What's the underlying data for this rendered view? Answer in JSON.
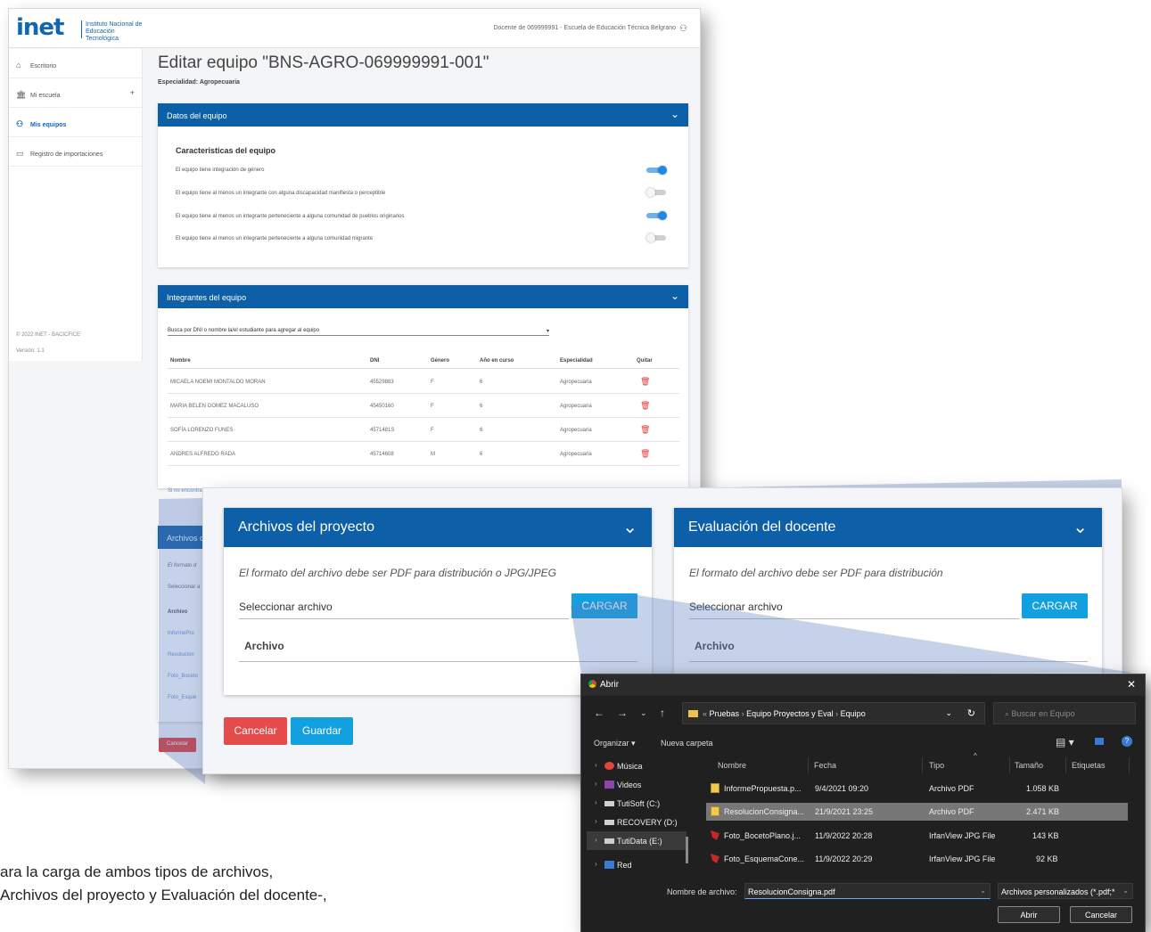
{
  "app": {
    "logo": "inet",
    "logo_subtitle": "Instituto Nacional de Educación Tecnológica",
    "teacher_label": "Docente de 069999991 - Escuela de Educación Técnica Belgrano"
  },
  "sidebar": {
    "items": [
      {
        "label": "Escritorio",
        "icon": "home-icon"
      },
      {
        "label": "Mi escuela",
        "icon": "school-icon",
        "expand": "+"
      },
      {
        "label": "Mis equipos",
        "icon": "team-icon",
        "active": true
      },
      {
        "label": "Registro de importaciones",
        "icon": "document-icon"
      }
    ],
    "footer_copyright": "© 2022 INET - BACICFICE",
    "footer_version": "Versión: 1.1"
  },
  "page": {
    "title": "Editar equipo \"BNS-AGRO-069999991-001\"",
    "specialty": "Especialidad: Agropecuaria"
  },
  "team_data": {
    "header": "Datos del equipo",
    "section_title": "Caracteristicas del equipo",
    "rows": [
      {
        "label": "El equipo tiene integración de género",
        "on": true
      },
      {
        "label": "El equipo tiene al menos un integrante con alguna discapacidad manifiesta o perceptible",
        "on": false
      },
      {
        "label": "El equipo tiene al menos un integrante perteneciente a alguna comunidad de pueblos originarios",
        "on": true
      },
      {
        "label": "El equipo tiene al menos un integrante perteneciente a alguna comunidad migrante",
        "on": false
      }
    ]
  },
  "members": {
    "header": "Integrantes del equipo",
    "search_placeholder": "Busca por DNI o nombre la/el estudiante para agregar al equipo",
    "columns": [
      "Nombre",
      "DNI",
      "Género",
      "Año en curso",
      "Especialidad",
      "Quitar"
    ],
    "rows": [
      [
        "MICAELA NOEMI MONTALDO MORAN",
        "45529883",
        "F",
        "6",
        "Agropecuaria"
      ],
      [
        "MARIA BELEN GOMEZ MACALUSO",
        "45450160",
        "F",
        "6",
        "Agropecuaria"
      ],
      [
        "SOFÍA LORENZO FUNES",
        "4571481S",
        "F",
        "6",
        "Agropecuaria"
      ],
      [
        "ANDRES ALFREDO RADA",
        "45714608",
        "M",
        "6",
        "Agropecuaria"
      ]
    ],
    "not_found": "Si no encontrante ella estudiante, agregala acá"
  },
  "files_small": {
    "header": "Archivos d",
    "note": "El formato d",
    "select": "Seleccionar a",
    "col": "Archivo",
    "rows": [
      "InformePro",
      "Resolucion",
      "Foto_Boceto",
      "Foto_Esque"
    ],
    "cancel": "Cancelar"
  },
  "project_files": {
    "header": "Archivos del proyecto",
    "note": "El formato del archivo debe ser PDF para distribución o JPG/JPEG",
    "select_placeholder": "Seleccionar archivo",
    "upload": "CARGAR",
    "column": "Archivo"
  },
  "teacher_eval": {
    "header": "Evaluación del docente",
    "note": "El formato del archivo debe ser PDF para distribución",
    "select_placeholder": "Seleccionar archivo",
    "upload": "CARGAR",
    "column": "Archivo"
  },
  "actions": {
    "cancel": "Cancelar",
    "save": "Guardar"
  },
  "dialog": {
    "title": "Abrir",
    "path": [
      "Pruebas",
      "Equipo Proyectos y Eval",
      "Equipo"
    ],
    "search_placeholder": "Buscar en Equipo",
    "organize": "Organizar ▾",
    "new_folder": "Nueva carpeta",
    "tree": [
      {
        "label": "Música",
        "color": "#e0463c"
      },
      {
        "label": "Videos",
        "color": "#8e44ad"
      },
      {
        "label": "TutiSoft (C:)",
        "color": "#cfcfcf"
      },
      {
        "label": "RECOVERY (D:)",
        "color": "#cfcfcf"
      },
      {
        "label": "TutiData (E:)",
        "color": "#cfcfcf",
        "selected": true
      },
      {
        "label": "Red",
        "color": "#3b7ad4"
      }
    ],
    "columns": [
      "Nombre",
      "Fecha",
      "Tipo",
      "Tamaño",
      "Etiquetas"
    ],
    "files": [
      {
        "name": "InformePropuesta.p...",
        "date": "9/4/2021 09:20",
        "type": "Archivo PDF",
        "size": "1.058 KB",
        "kind": "pdf"
      },
      {
        "name": "ResolucionConsigna...",
        "date": "21/9/2021 23:25",
        "type": "Archivo PDF",
        "size": "2.471 KB",
        "kind": "pdf",
        "selected": true
      },
      {
        "name": "Foto_BocetoPlano.j...",
        "date": "11/9/2022 20:28",
        "type": "IrfanView JPG File",
        "size": "143 KB",
        "kind": "jpg"
      },
      {
        "name": "Foto_EsquemaCone...",
        "date": "11/9/2022 20:29",
        "type": "IrfanView JPG File",
        "size": "92 KB",
        "kind": "jpg"
      }
    ],
    "filename_label": "Nombre de archivo:",
    "filename_value": "ResolucionConsigna.pdf",
    "filter": "Archivos personalizados (*.pdf;*",
    "open": "Abrir",
    "cancel": "Cancelar"
  },
  "caption": {
    "line1": "ara la carga de ambos tipos de archivos,",
    "line2": "Archivos del proyecto y Evaluación del docente-,"
  }
}
